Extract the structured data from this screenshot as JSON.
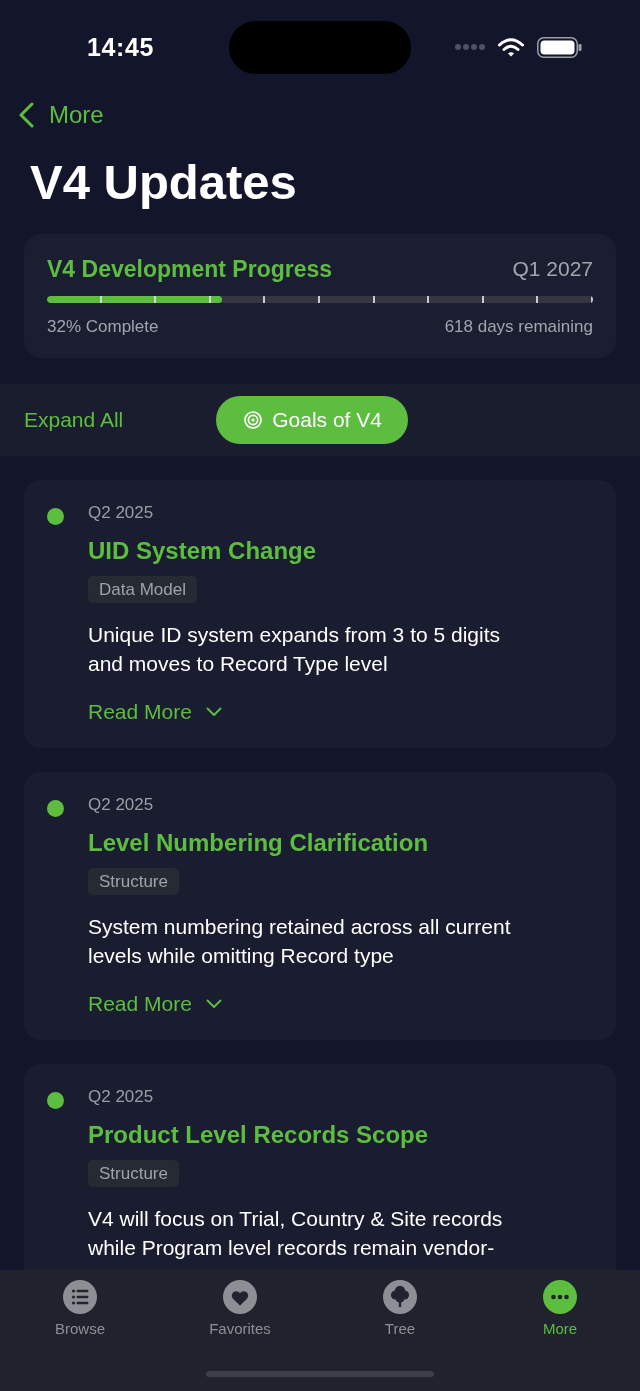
{
  "status_bar": {
    "time": "14:45"
  },
  "nav": {
    "back": "More",
    "title": "V4 Updates"
  },
  "progress": {
    "title": "V4 Development Progress",
    "target": "Q1 2027",
    "level": 0.32,
    "complete": "32% Complete",
    "remaining": "618 days remaining"
  },
  "toolbar": {
    "expand": "Expand All",
    "goals": "Goals of V4"
  },
  "updates": [
    {
      "date": "Q2 2025",
      "title": "UID System Change",
      "tag": "Data Model",
      "description": "Unique ID system expands from 3 to 5 digits and moves to Record Type level",
      "read_more": "Read More",
      "expanded": false
    },
    {
      "date": "Q2 2025",
      "title": "Level Numbering Clarification",
      "tag": "Structure",
      "description": "System numbering retained across all current levels while omitting Record type",
      "read_more": "Read More",
      "expanded": false
    },
    {
      "date": "Q2 2025",
      "title": "Product Level Records Scope",
      "tag": "Structure",
      "description": "V4 will focus on Trial, Country & Site records while Program level records remain vendor-"
    }
  ],
  "tab_bar": [
    {
      "label": "Browse",
      "selected": false
    },
    {
      "label": "Favorites",
      "selected": false
    },
    {
      "label": "Tree",
      "selected": false
    },
    {
      "label": "More",
      "selected": true
    }
  ]
}
